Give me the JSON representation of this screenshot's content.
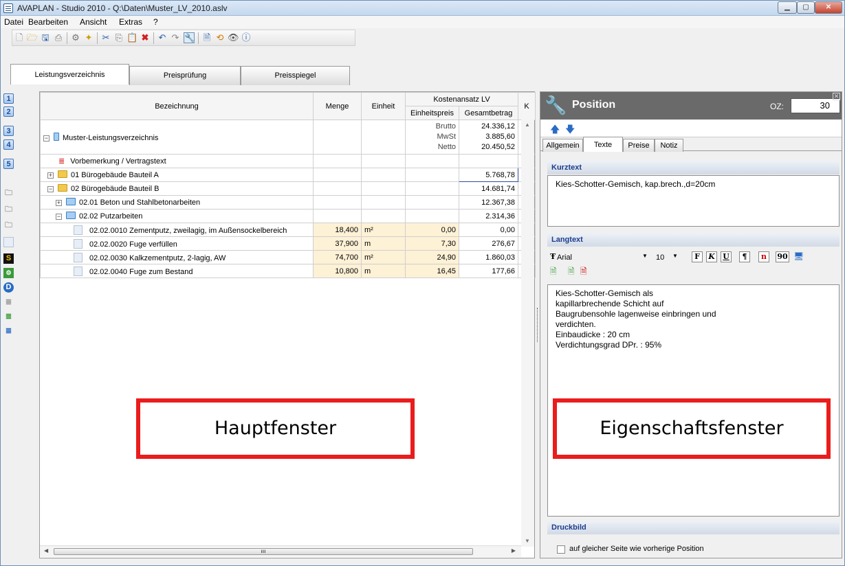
{
  "window": {
    "title": "AVAPLAN - Studio 2010 - Q:\\Daten\\Muster_LV_2010.aslv"
  },
  "menu": [
    "Datei",
    "Bearbeiten",
    "Ansicht",
    "Extras",
    "?"
  ],
  "tabs": [
    "Leistungsverzeichnis",
    "Preisprüfung",
    "Preisspiegel"
  ],
  "sidebar": {
    "numbers": [
      "1",
      "2",
      "3",
      "4",
      "5"
    ],
    "s_label": "S",
    "d_label": "D"
  },
  "grid": {
    "headers": {
      "bezeichnung": "Bezeichnung",
      "menge": "Menge",
      "einheit": "Einheit",
      "kostenansatz": "Kostenansatz LV",
      "einheitspreis": "Einheitspreis",
      "gesamtbetrag": "Gesamtbetrag",
      "k": "K"
    },
    "root": {
      "label": "Muster-Leistungsverzeichnis",
      "brutto_label": "Brutto",
      "brutto": "24.336,12",
      "mwst_label": "MwSt",
      "mwst": "3.885,60",
      "netto_label": "Netto",
      "netto": "20.450,52"
    },
    "vorbemerkung": "Vorbemerkung / Vertragstext",
    "groups": [
      {
        "label": "01  Bürogebäude Bauteil A",
        "total": "5.768,78"
      },
      {
        "label": "02  Bürogebäude Bauteil B",
        "total": "14.681,74"
      },
      {
        "label": "02.01  Beton und Stahlbetonarbeiten",
        "total": "12.367,38"
      },
      {
        "label": "02.02  Putzarbeiten",
        "total": "2.314,36"
      }
    ],
    "positions": [
      {
        "label": "02.02.0010  Zementputz, zweilagig, im Außensockelbereich",
        "menge": "18,400",
        "einheit": "m²",
        "ep": "0,00",
        "gb": "0,00"
      },
      {
        "label": "02.02.0020  Fuge verfüllen",
        "menge": "37,900",
        "einheit": "m",
        "ep": "7,30",
        "gb": "276,67"
      },
      {
        "label": "02.02.0030  Kalkzementputz, 2-lagig, AW",
        "menge": "74,700",
        "einheit": "m²",
        "ep": "24,90",
        "gb": "1.860,03"
      },
      {
        "label": "02.02.0040  Fuge zum Bestand",
        "menge": "10,800",
        "einheit": "m",
        "ep": "16,45",
        "gb": "177,66"
      }
    ]
  },
  "callouts": {
    "main": "Hauptfenster",
    "props": "Eigenschaftsfenster"
  },
  "panel": {
    "title": "Position",
    "oz_label": "OZ:",
    "oz_value": "30",
    "tabs": [
      "Allgemein",
      "Texte",
      "Preise",
      "Notiz"
    ],
    "kurztext_header": "Kurztext",
    "kurztext": "Kies-Schotter-Gemisch, kap.brech.,d=20cm",
    "langtext_header": "Langtext",
    "font_name": "Arial",
    "font_size": "10",
    "format_buttons": [
      "F",
      "K",
      "U",
      "¶",
      "n",
      "90"
    ],
    "langtext": [
      "Kies-Schotter-Gemisch als",
      "kapillarbrechende Schicht auf",
      "Baugrubensohle lagenweise einbringen und",
      "verdichten.",
      "Einbaudicke : 20 cm",
      "Verdichtungsgrad DPr. : 95%"
    ],
    "druckbild_header": "Druckbild",
    "checkbox_label": "auf gleicher Seite wie vorherige Position"
  },
  "colors": {
    "accent_red": "#ea1c1c",
    "header_dark": "#6a6a6a",
    "section_text": "#1b3d8c",
    "input_yellow": "#fdf1d6"
  }
}
